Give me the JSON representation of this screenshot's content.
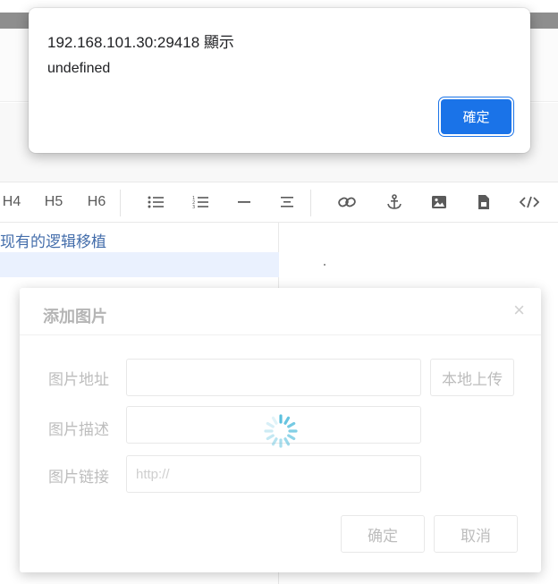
{
  "alert": {
    "title": "192.168.101.30:29418 顯示",
    "message": "undefined",
    "ok_label": "確定"
  },
  "toolbar": {
    "h4": "H4",
    "h5": "H5",
    "h6": "H6",
    "icons": [
      "unordered-list-icon",
      "ordered-list-icon",
      "horizontal-rule-icon",
      "align-center-icon",
      "link-icon",
      "anchor-icon",
      "image-icon",
      "file-icon",
      "code-icon"
    ]
  },
  "editor": {
    "line1": "现有的逻辑移植"
  },
  "image_modal": {
    "title": "添加图片",
    "close": "×",
    "url_label": "图片地址",
    "desc_label": "图片描述",
    "link_label": "图片链接",
    "link_placeholder": "http://",
    "upload_label": "本地上传",
    "confirm_label": "确定",
    "cancel_label": "取消"
  },
  "colors": {
    "accent": "#1a73e8",
    "spinner": "#5bc0de"
  }
}
